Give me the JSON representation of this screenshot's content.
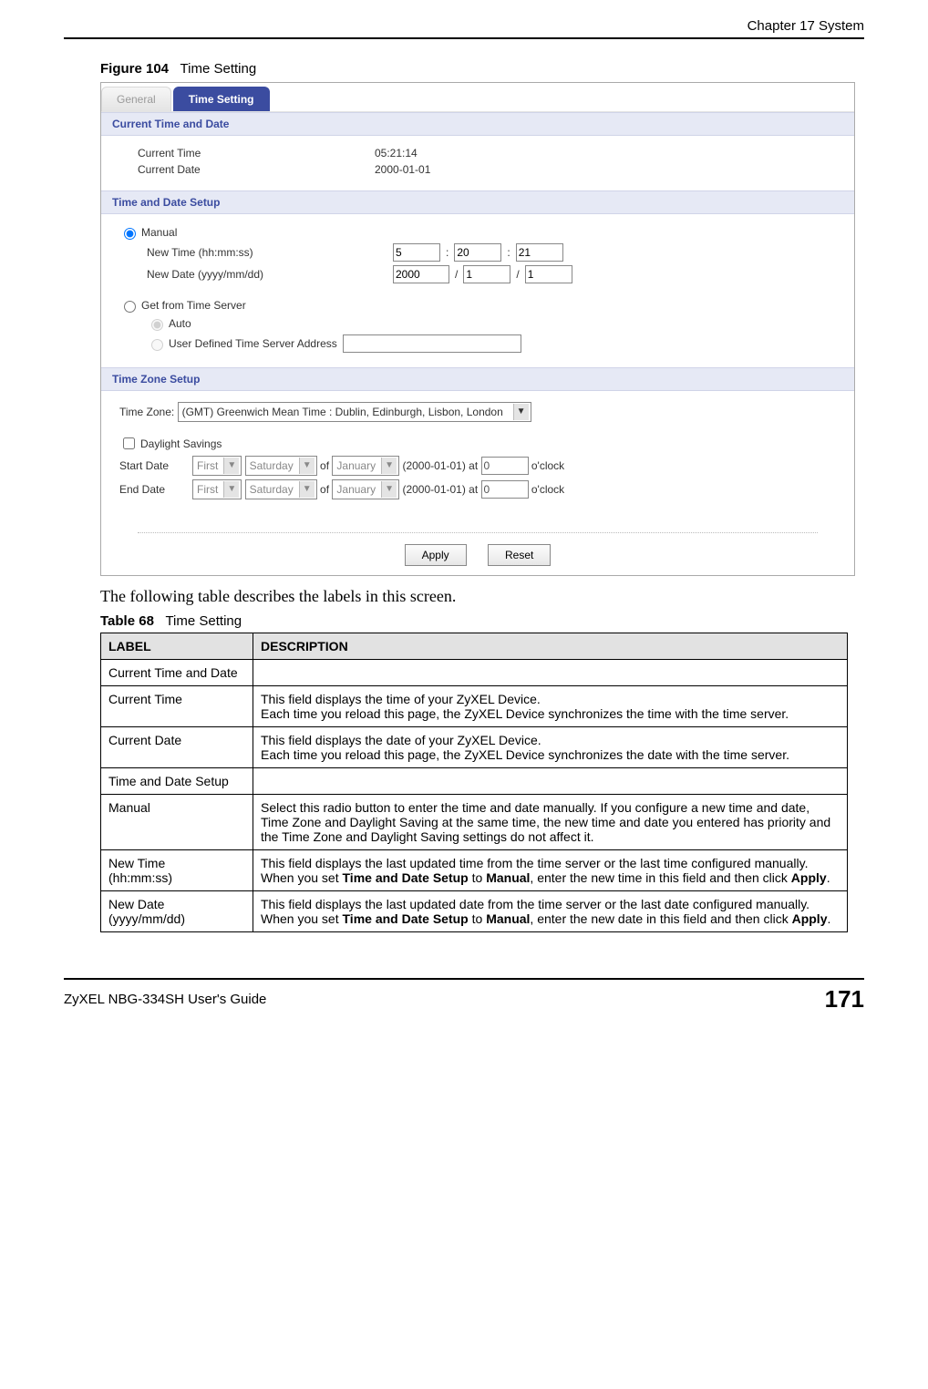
{
  "header": {
    "chapter": "Chapter 17 System"
  },
  "figure": {
    "number": "Figure 104",
    "caption": "Time Setting"
  },
  "screenshot": {
    "tabs": {
      "general": "General",
      "timesetting": "Time Setting"
    },
    "sections": {
      "current": {
        "title": "Current Time and Date",
        "current_time_label": "Current Time",
        "current_time_value": "05:21:14",
        "current_date_label": "Current Date",
        "current_date_value": "2000-01-01"
      },
      "setup": {
        "title": "Time and Date Setup",
        "manual_label": "Manual",
        "new_time_label": "New Time (hh:mm:ss)",
        "time_hh": "5",
        "time_mm": "20",
        "time_ss": "21",
        "time_sep": ":",
        "new_date_label": "New Date (yyyy/mm/dd)",
        "date_y": "2000",
        "date_m": "1",
        "date_d": "1",
        "date_sep": "/",
        "get_server_label": "Get from Time Server",
        "auto_label": "Auto",
        "user_defined_label": "User Defined Time Server Address",
        "user_defined_value": ""
      },
      "tz": {
        "title": "Time Zone Setup",
        "time_zone_label": "Time Zone:",
        "time_zone_value": "(GMT) Greenwich Mean Time : Dublin, Edinburgh, Lisbon, London",
        "daylight_label": "Daylight Savings",
        "start_label": "Start Date",
        "end_label": "End Date",
        "ordinal": "First",
        "weekday": "Saturday",
        "of": "of",
        "month": "January",
        "date_paren": "(2000-01-01)",
        "at": "at",
        "hour": "0",
        "oclock": "o'clock"
      }
    },
    "buttons": {
      "apply": "Apply",
      "reset": "Reset"
    }
  },
  "intro": "The following table describes the labels in this screen.",
  "table": {
    "number": "Table 68",
    "caption": "Time Setting",
    "head_label": "LABEL",
    "head_desc": "DESCRIPTION",
    "rows": [
      {
        "label": "Current Time and Date",
        "desc": ""
      },
      {
        "label": "Current Time",
        "desc": "This field displays the time of your ZyXEL Device.\nEach time you reload this page, the ZyXEL Device synchronizes the time with the time server."
      },
      {
        "label": "Current Date",
        "desc": "This field displays the date of your ZyXEL Device.\nEach time you reload this page, the ZyXEL Device synchronizes the date with the time server."
      },
      {
        "label": "Time and Date Setup",
        "desc": ""
      },
      {
        "label": "Manual",
        "desc": "Select this radio button to enter the time and date manually. If you configure a new time and date, Time Zone and Daylight Saving at the same time, the new time and date you entered has priority and the Time Zone and Daylight Saving settings do not affect it."
      },
      {
        "label": "New Time\n (hh:mm:ss)",
        "desc": "This field displays the last updated time from the time server or the last time configured manually.\nWhen you set Time and Date Setup to Manual, enter the new time in this field and then click Apply."
      },
      {
        "label": "New Date\n(yyyy/mm/dd)",
        "desc": "This field displays the last updated date from the time server or the last date configured manually.\nWhen you set Time and Date Setup to Manual, enter the new date in this field and then click Apply."
      }
    ]
  },
  "footer": {
    "guide": "ZyXEL NBG-334SH User's Guide",
    "page": "171"
  }
}
